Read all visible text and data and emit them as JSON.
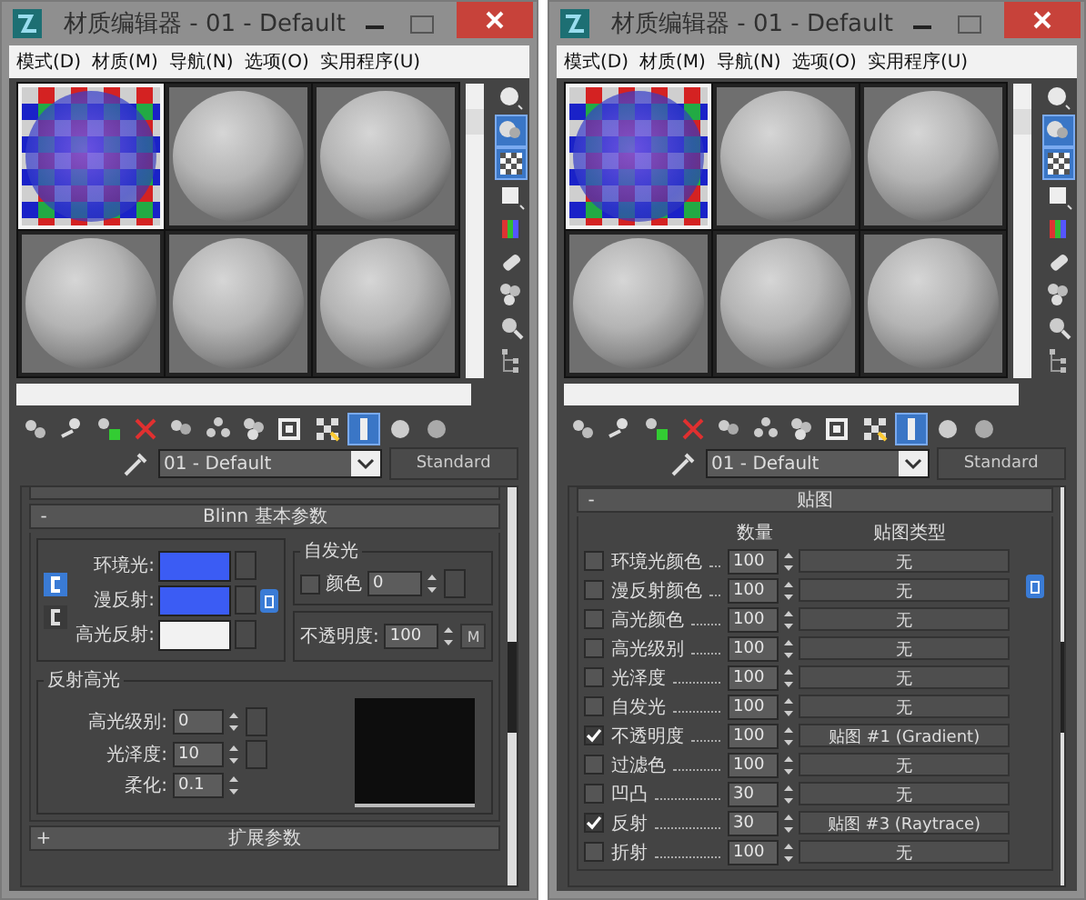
{
  "windows": [
    {
      "title": "材质编辑器 - 01 - Default",
      "menu": [
        "模式(D)",
        "材质(M)",
        "导航(N)",
        "选项(O)",
        "实用程序(U)"
      ],
      "slots": [
        {
          "kind": "checker",
          "selected": true
        },
        {
          "kind": "sphere",
          "selected": false
        },
        {
          "kind": "sphere",
          "selected": false
        },
        {
          "kind": "sphere",
          "selected": false
        },
        {
          "kind": "sphere",
          "selected": false
        },
        {
          "kind": "sphere",
          "selected": false
        }
      ],
      "side_tools": [
        {
          "on": false
        },
        {
          "on": true
        },
        {
          "on": true
        },
        {
          "on": false
        },
        {
          "on": false
        },
        {
          "on": false
        },
        {
          "on": false
        },
        {
          "on": false
        },
        {
          "on": false
        }
      ],
      "tools": [
        {
          "on": false
        },
        {
          "on": false
        },
        {
          "on": false
        },
        {
          "on": false
        },
        {
          "on": false
        },
        {
          "on": false
        },
        {
          "on": false
        },
        {
          "on": false
        },
        {
          "on": false
        },
        {
          "on": true
        },
        {
          "on": false
        },
        {
          "on": false
        }
      ],
      "material_name": "01 - Default",
      "material_type": "Standard",
      "panel": {
        "kind": "blinn",
        "rollout": {
          "toggle": "-",
          "title": "Blinn 基本参数"
        },
        "colors": [
          {
            "label": "环境光:",
            "color": "#3b5cf4"
          },
          {
            "label": "漫反射:",
            "color": "#3b5cf4"
          },
          {
            "label": "高光反射:",
            "color": "#f2f2f2"
          }
        ],
        "self_illum": {
          "title": "自发光",
          "label": "颜色",
          "checked": false,
          "value": "0"
        },
        "opacity": {
          "label": "不透明度:",
          "value": "100",
          "button": "M"
        },
        "specular": {
          "title": "反射高光",
          "fields": [
            {
              "label": "高光级别:",
              "value": "0"
            },
            {
              "label": "光泽度:",
              "value": "10"
            },
            {
              "label": "柔化:",
              "value": "0.1"
            }
          ]
        },
        "next_rollout": {
          "toggle": "+",
          "title": "扩展参数"
        }
      }
    },
    {
      "title": "材质编辑器 - 01 - Default",
      "menu": [
        "模式(D)",
        "材质(M)",
        "导航(N)",
        "选项(O)",
        "实用程序(U)"
      ],
      "slots": [
        {
          "kind": "checker",
          "selected": true
        },
        {
          "kind": "sphere",
          "selected": false
        },
        {
          "kind": "sphere",
          "selected": false
        },
        {
          "kind": "sphere",
          "selected": false
        },
        {
          "kind": "sphere",
          "selected": false
        },
        {
          "kind": "sphere",
          "selected": false
        }
      ],
      "side_tools": [
        {
          "on": false
        },
        {
          "on": true
        },
        {
          "on": true
        },
        {
          "on": false
        },
        {
          "on": false
        },
        {
          "on": false
        },
        {
          "on": false
        },
        {
          "on": false
        },
        {
          "on": false
        }
      ],
      "tools": [
        {
          "on": false
        },
        {
          "on": false
        },
        {
          "on": false
        },
        {
          "on": false
        },
        {
          "on": false
        },
        {
          "on": false
        },
        {
          "on": false
        },
        {
          "on": false
        },
        {
          "on": false
        },
        {
          "on": true
        },
        {
          "on": false
        },
        {
          "on": false
        }
      ],
      "material_name": "01 - Default",
      "material_type": "Standard",
      "panel": {
        "kind": "maps",
        "rollout": {
          "toggle": "-",
          "title": "贴图"
        },
        "headings": [
          "数量",
          "贴图类型"
        ],
        "rows": [
          {
            "label": "环境光颜色",
            "checked": false,
            "amount": "100",
            "map": "无"
          },
          {
            "label": "漫反射颜色",
            "checked": false,
            "amount": "100",
            "map": "无"
          },
          {
            "label": "高光颜色",
            "checked": false,
            "amount": "100",
            "map": "无"
          },
          {
            "label": "高光级别",
            "checked": false,
            "amount": "100",
            "map": "无"
          },
          {
            "label": "光泽度",
            "checked": false,
            "amount": "100",
            "map": "无"
          },
          {
            "label": "自发光",
            "checked": false,
            "amount": "100",
            "map": "无"
          },
          {
            "label": "不透明度",
            "checked": true,
            "amount": "100",
            "map": "贴图 #1 (Gradient)"
          },
          {
            "label": "过滤色",
            "checked": false,
            "amount": "100",
            "map": "无"
          },
          {
            "label": "凹凸",
            "checked": false,
            "amount": "30",
            "map": "无"
          },
          {
            "label": "反射",
            "checked": true,
            "amount": "30",
            "map": "贴图 #3 (Raytrace)"
          },
          {
            "label": "折射",
            "checked": false,
            "amount": "100",
            "map": "无"
          }
        ]
      }
    }
  ]
}
